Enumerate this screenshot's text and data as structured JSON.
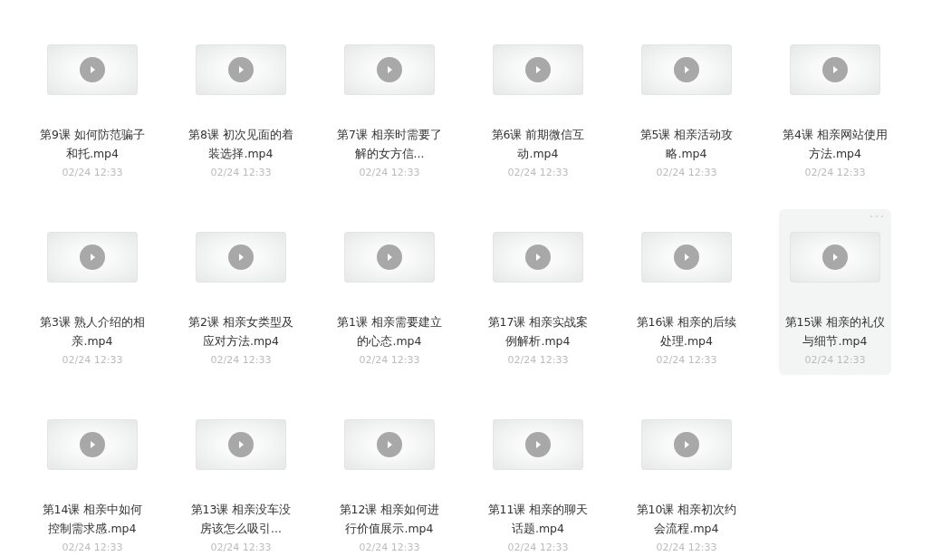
{
  "files": [
    {
      "title": "第9课 如何防范骗子和托.mp4",
      "date": "02/24 12:33",
      "highlighted": false
    },
    {
      "title": "第8课 初次见面的着装选择.mp4",
      "date": "02/24 12:33",
      "highlighted": false
    },
    {
      "title": "第7课 相亲时需要了解的女方信...",
      "date": "02/24 12:33",
      "highlighted": false
    },
    {
      "title": "第6课 前期微信互动.mp4",
      "date": "02/24 12:33",
      "highlighted": false
    },
    {
      "title": "第5课 相亲活动攻略.mp4",
      "date": "02/24 12:33",
      "highlighted": false
    },
    {
      "title": "第4课 相亲网站使用方法.mp4",
      "date": "02/24 12:33",
      "highlighted": false
    },
    {
      "title": "第3课 熟人介绍的相亲.mp4",
      "date": "02/24 12:33",
      "highlighted": false
    },
    {
      "title": "第2课 相亲女类型及应对方法.mp4",
      "date": "02/24 12:33",
      "highlighted": false
    },
    {
      "title": "第1课 相亲需要建立的心态.mp4",
      "date": "02/24 12:33",
      "highlighted": false
    },
    {
      "title": "第17课 相亲实战案例解析.mp4",
      "date": "02/24 12:33",
      "highlighted": false
    },
    {
      "title": "第16课 相亲的后续处理.mp4",
      "date": "02/24 12:33",
      "highlighted": false
    },
    {
      "title": "第15课 相亲的礼仪与细节.mp4",
      "date": "02/24 12:33",
      "highlighted": true
    },
    {
      "title": "第14课 相亲中如何控制需求感.mp4",
      "date": "02/24 12:33",
      "highlighted": false
    },
    {
      "title": "第13课 相亲没车没房该怎么吸引...",
      "date": "02/24 12:33",
      "highlighted": false
    },
    {
      "title": "第12课 相亲如何进行价值展示.mp4",
      "date": "02/24 12:33",
      "highlighted": false
    },
    {
      "title": "第11课 相亲的聊天话题.mp4",
      "date": "02/24 12:33",
      "highlighted": false
    },
    {
      "title": "第10课 相亲初次约会流程.mp4",
      "date": "02/24 12:33",
      "highlighted": false
    }
  ]
}
